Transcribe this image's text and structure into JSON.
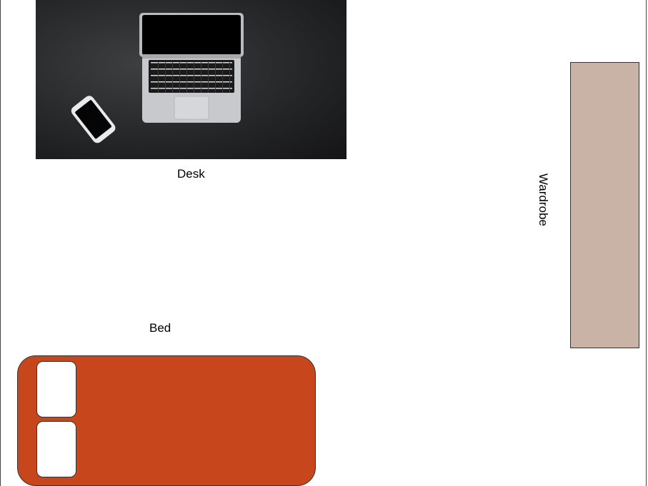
{
  "labels": {
    "desk": "Desk",
    "bed": "Bed",
    "wardrobe": "Wardrobe"
  },
  "colors": {
    "desk_photo_background": "#2a2b2d",
    "wardrobe": "#c9b2a6",
    "bed": "#c8461b",
    "pillow": "#ffffff"
  },
  "icons": {
    "desk_photo": "laptop-and-phone-on-dark-desk"
  }
}
